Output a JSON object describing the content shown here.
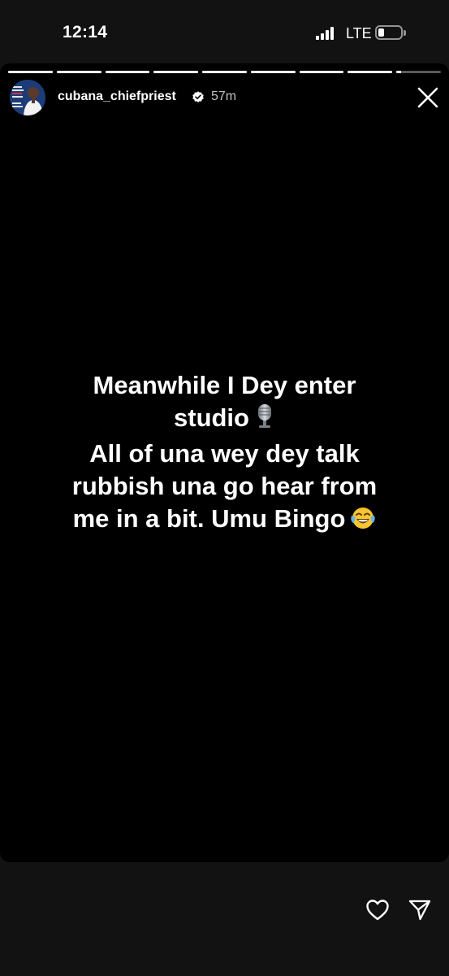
{
  "status_bar": {
    "time": "12:14",
    "network": "LTE",
    "signal_icon": "cellular-signal-icon",
    "battery_icon": "battery-low-icon",
    "battery_level": 0.2
  },
  "story": {
    "segment_count": 9,
    "progress": [
      1,
      1,
      1,
      1,
      1,
      1,
      1,
      1,
      0.1
    ],
    "username": "cubana_chiefpriest",
    "verified_icon": "verified-badge-icon",
    "age": "57m",
    "close_icon": "close-icon",
    "text_lines": [
      "Meanwhile I Dey enter",
      "studio",
      "All of una wey dey talk",
      "rubbish una go hear from",
      "me in a bit. Umu Bingo"
    ],
    "emoji_1": "microphone-emoji",
    "emoji_2": "tears-of-joy-emoji"
  },
  "actions": {
    "like_icon": "heart-icon",
    "share_icon": "send-icon"
  },
  "colors": {
    "background": "#121212",
    "card": "#000000",
    "text": "#ffffff",
    "verified": "#3897f0"
  }
}
